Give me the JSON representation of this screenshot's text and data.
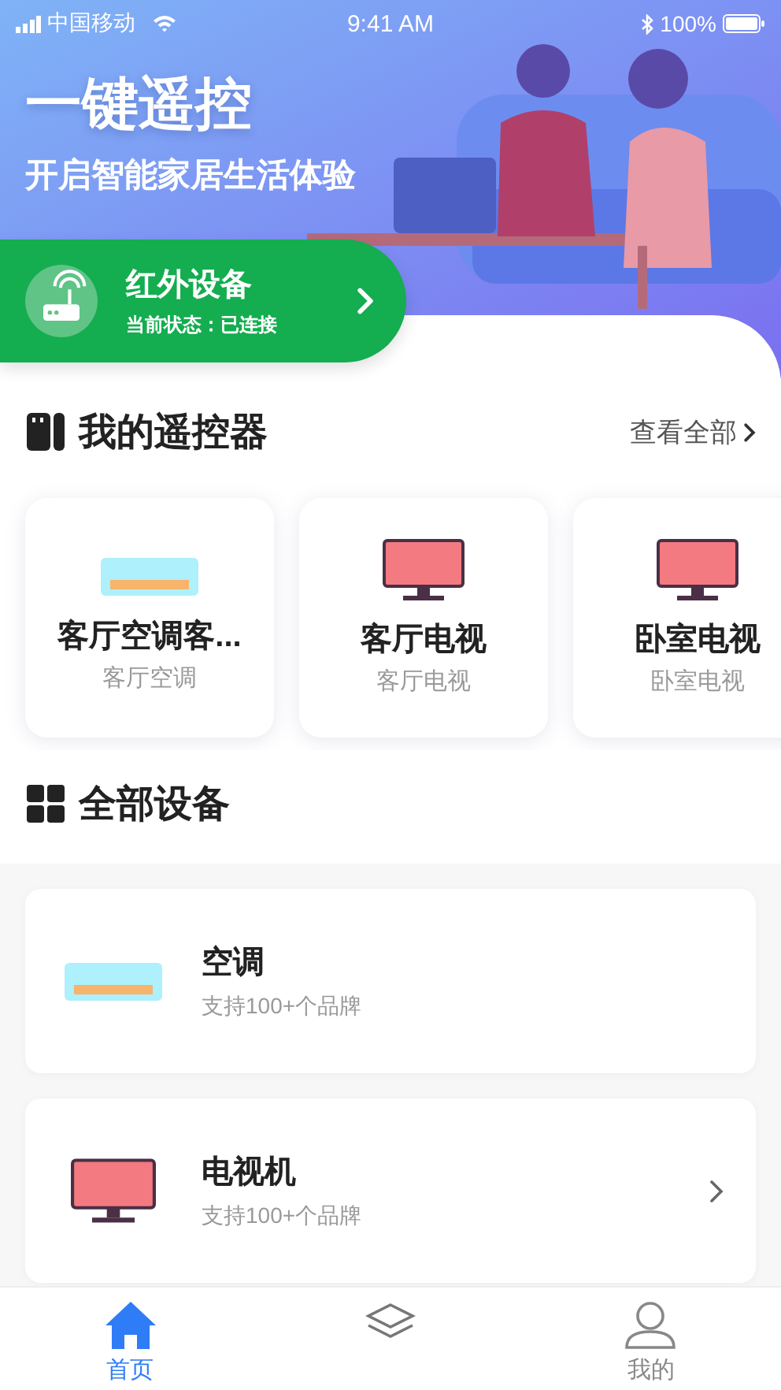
{
  "status_bar": {
    "carrier": "中国移动",
    "time": "9:41 AM",
    "battery": "100%"
  },
  "hero": {
    "title": "一键遥控",
    "subtitle": "开启智能家居生活体验"
  },
  "ir_device": {
    "title": "红外设备",
    "status": "当前状态：已连接"
  },
  "remotes": {
    "title": "我的遥控器",
    "view_all": "查看全部",
    "items": [
      {
        "kind": "ac",
        "name": "客厅空调客...",
        "room": "客厅空调"
      },
      {
        "kind": "tv",
        "name": "客厅电视",
        "room": "客厅电视"
      },
      {
        "kind": "tv",
        "name": "卧室电视",
        "room": "卧室电视"
      }
    ]
  },
  "devices": {
    "title": "全部设备",
    "items": [
      {
        "kind": "ac",
        "name": "空调",
        "desc": "支持100+个品牌",
        "arrow": false
      },
      {
        "kind": "tv",
        "name": "电视机",
        "desc": "支持100+个品牌",
        "arrow": true
      }
    ]
  },
  "tab_bar": [
    {
      "kind": "home",
      "label": "首页",
      "selected": true
    },
    {
      "kind": "layers",
      "selected": false
    },
    {
      "kind": "user",
      "label": "我的",
      "selected": false
    }
  ]
}
